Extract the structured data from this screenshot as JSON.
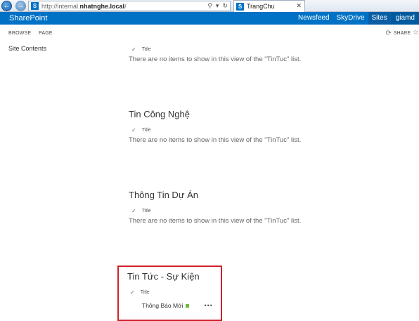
{
  "browser": {
    "url_prefix": "http://internal.",
    "url_domain": "nhatnghe.local",
    "url_suffix": "/",
    "tab_title": "TrangChu",
    "favicon_glyph": "S"
  },
  "suite": {
    "brand": "SharePoint",
    "links": [
      "Newsfeed",
      "SkyDrive",
      "Sites"
    ],
    "user": "giamd"
  },
  "ribbon": {
    "tabs": [
      "BROWSE",
      "PAGE"
    ],
    "share_label": "SHARE"
  },
  "quicklaunch": {
    "site_contents": "Site Contents"
  },
  "webparts": [
    {
      "title": "",
      "column_header": "Title",
      "empty_message": "There are no items to show in this view of the \"TinTuc\" list."
    },
    {
      "title": "Tin Công Nghệ",
      "column_header": "Title",
      "empty_message": "There are no items to show in this view of the \"TinTuc\" list."
    },
    {
      "title": "Thông Tin Dự Án",
      "column_header": "Title",
      "empty_message": "There are no items to show in this view of the \"TinTuc\" list."
    },
    {
      "title": "Tin Tức - Sự Kiện",
      "column_header": "Title",
      "items": [
        "Thông Báo Mới"
      ],
      "item_menu": "•••"
    }
  ],
  "colors": {
    "suite_blue": "#0072c6",
    "highlight_red": "#d0202a",
    "new_badge_green": "#6fb83f"
  }
}
